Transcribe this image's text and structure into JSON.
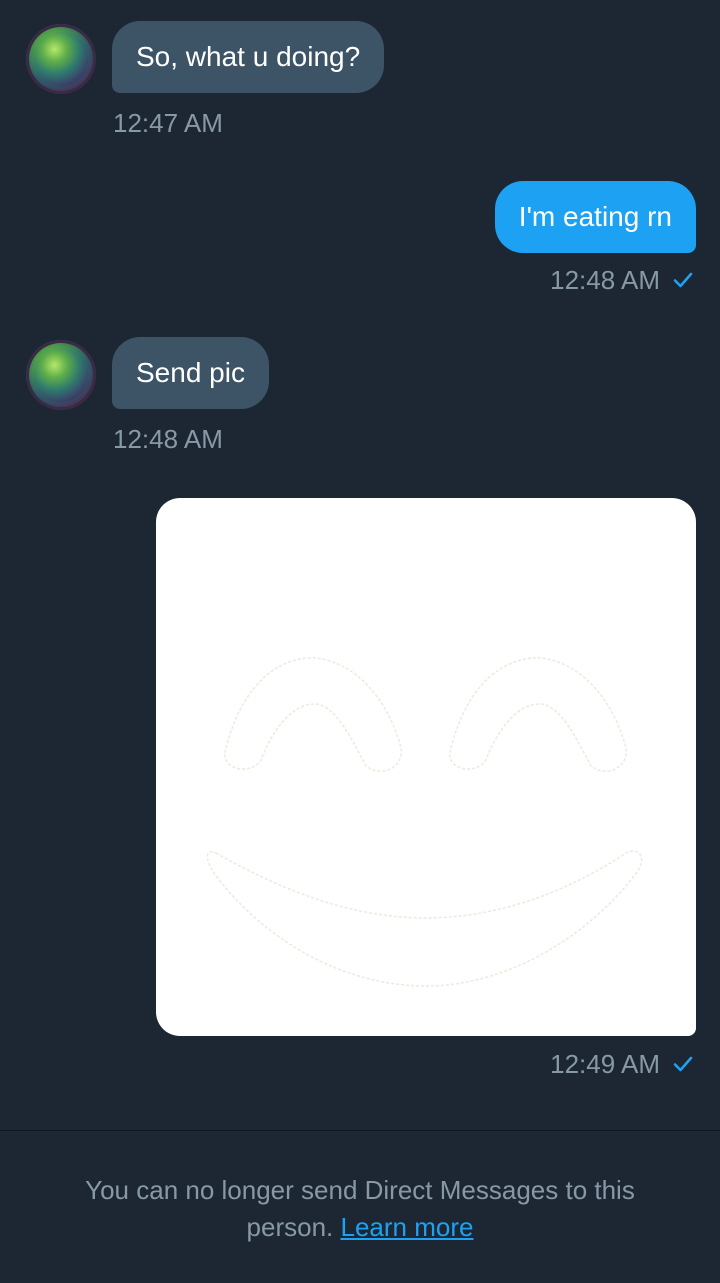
{
  "messages": [
    {
      "direction": "incoming",
      "text": "So, what u doing?",
      "time": "12:47 AM"
    },
    {
      "direction": "outgoing",
      "text": "I'm eating rn",
      "time": "12:48 AM"
    },
    {
      "direction": "incoming",
      "text": "Send pic",
      "time": "12:48 AM"
    },
    {
      "direction": "outgoing",
      "type": "image",
      "image_content": "smiling-face",
      "time": "12:49 AM"
    }
  ],
  "footer": {
    "notice": "You can no longer send Direct Messages to this person.",
    "link": "Learn more"
  },
  "colors": {
    "background": "#1c2733",
    "incoming_bubble": "#3d5466",
    "outgoing_bubble": "#1da1f2",
    "timestamp": "#8899a6",
    "link": "#1da1f2"
  },
  "icons": {
    "read_receipt": "check-icon",
    "avatar": "avatar"
  }
}
